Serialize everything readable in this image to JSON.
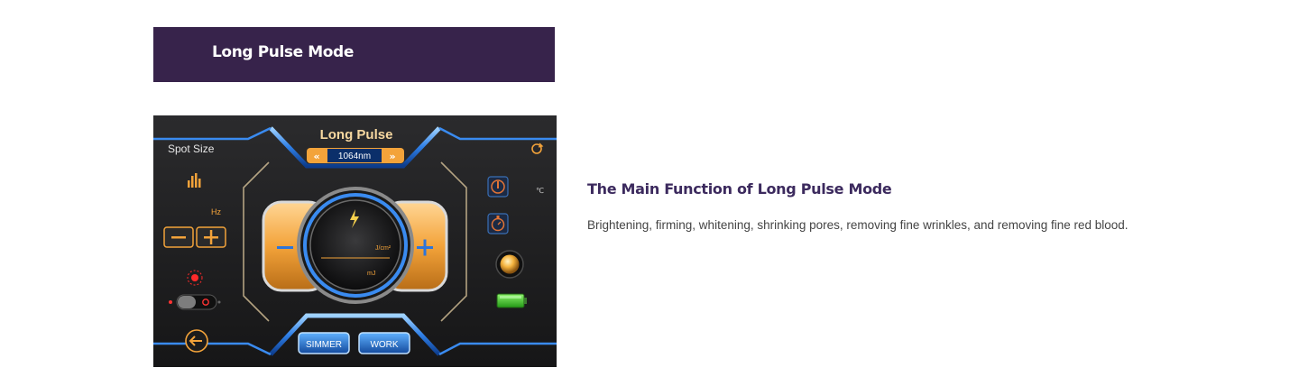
{
  "banner": {
    "title": "Long Pulse Mode"
  },
  "device": {
    "mode_title": "Long Pulse",
    "wavelength": "1064nm",
    "spot_size_label": "Spot Size",
    "hz_label": "Hz",
    "temp_unit": "℃",
    "fluence_unit": "J/cm²",
    "energy_unit": "mJ",
    "simmer_label": "SIMMER",
    "work_label": "WORK",
    "accent_color": "#f3a33a",
    "blue_color": "#3a8bf0",
    "icons": [
      "bars-icon",
      "minus-icon",
      "plus-icon",
      "laser-icon",
      "toggle-switch",
      "back-arrow-icon",
      "refresh-icon",
      "thermometer-icon",
      "timer-icon",
      "indicator-light",
      "battery-icon",
      "lightning-icon"
    ]
  },
  "info": {
    "title": "The Main Function of Long Pulse Mode",
    "description": "Brightening, firming, whitening, shrinking pores, removing fine wrinkles, and removing fine red blood."
  }
}
